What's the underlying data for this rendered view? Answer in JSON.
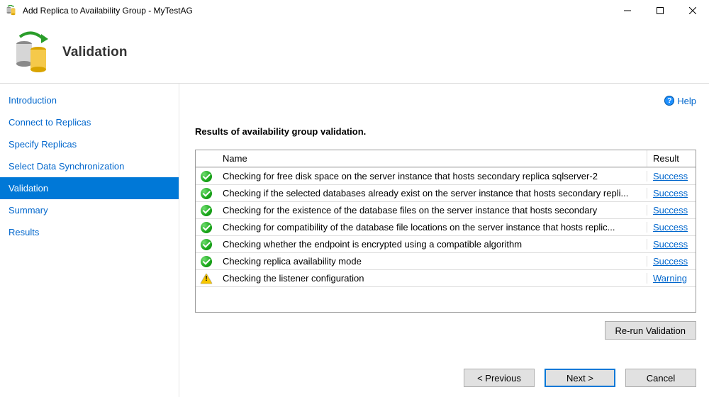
{
  "window": {
    "title": "Add Replica to Availability Group - MyTestAG"
  },
  "banner": {
    "title": "Validation"
  },
  "help": {
    "label": "Help"
  },
  "sidebar": {
    "items": [
      {
        "label": "Introduction"
      },
      {
        "label": "Connect to Replicas"
      },
      {
        "label": "Specify Replicas"
      },
      {
        "label": "Select Data Synchronization"
      },
      {
        "label": "Validation"
      },
      {
        "label": "Summary"
      },
      {
        "label": "Results"
      }
    ],
    "selected_index": 4
  },
  "main": {
    "heading": "Results of availability group validation.",
    "columns": {
      "name": "Name",
      "result": "Result"
    },
    "rows": [
      {
        "status": "success",
        "name": "Checking for free disk space on the server instance that hosts secondary replica sqlserver-2",
        "result": "Success"
      },
      {
        "status": "success",
        "name": "Checking if the selected databases already exist on the server instance that hosts secondary repli...",
        "result": "Success"
      },
      {
        "status": "success",
        "name": "Checking for the existence of the database files on the server instance that hosts secondary",
        "result": "Success"
      },
      {
        "status": "success",
        "name": "Checking for compatibility of the database file locations on the server instance that hosts replic...",
        "result": "Success"
      },
      {
        "status": "success",
        "name": "Checking whether the endpoint is encrypted using a compatible algorithm",
        "result": "Success"
      },
      {
        "status": "success",
        "name": "Checking replica availability mode",
        "result": "Success"
      },
      {
        "status": "warning",
        "name": "Checking the listener configuration",
        "result": "Warning"
      }
    ],
    "rerun_label": "Re-run Validation"
  },
  "footer": {
    "previous": "< Previous",
    "next": "Next >",
    "cancel": "Cancel"
  }
}
